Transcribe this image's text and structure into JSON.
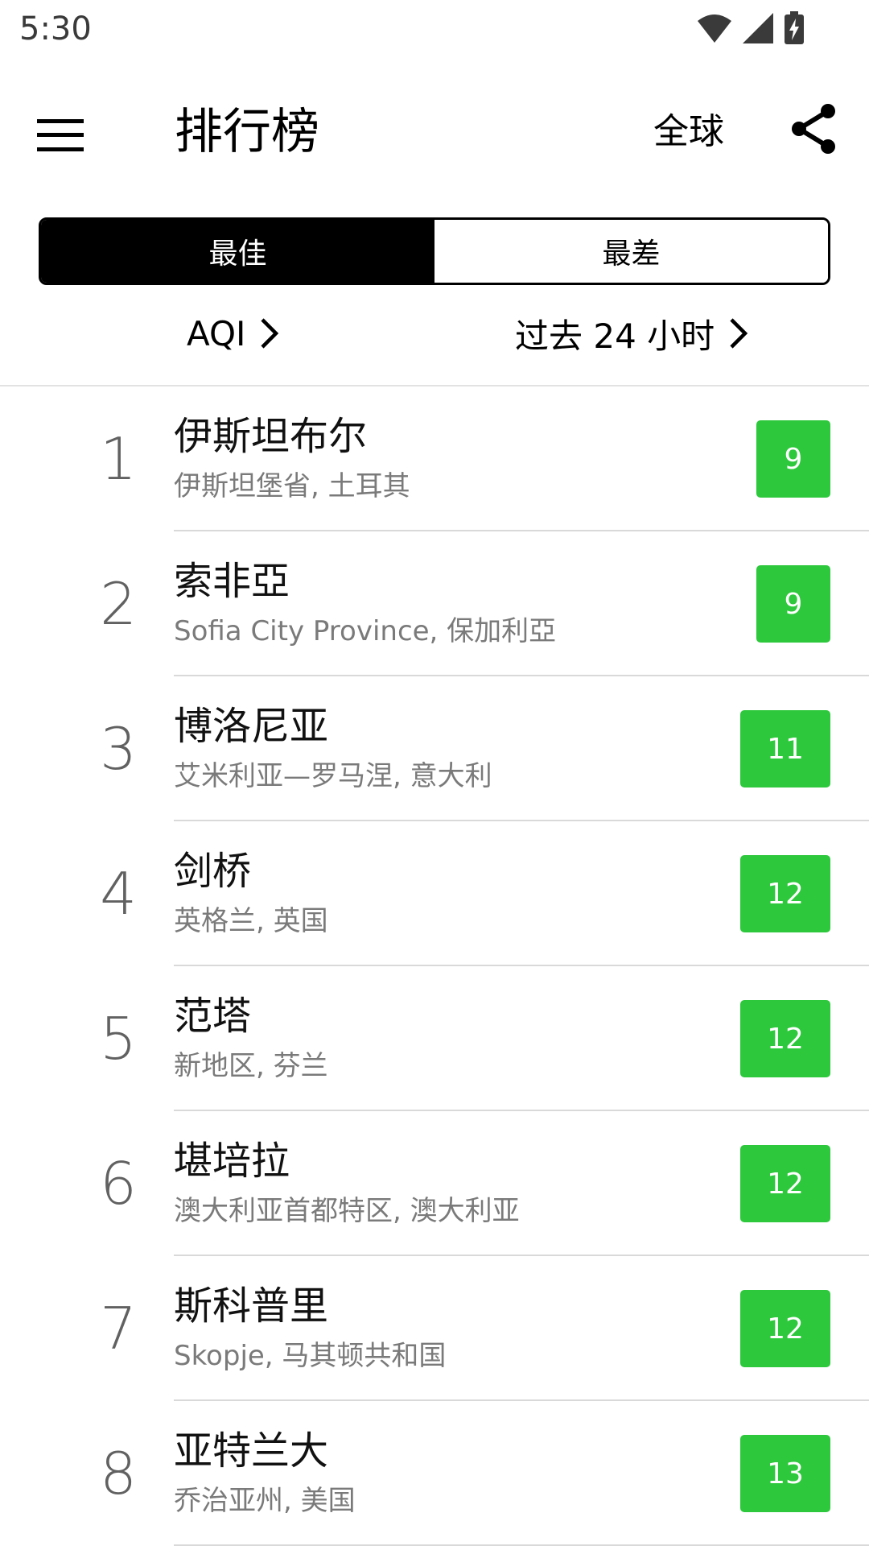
{
  "status_bar": {
    "time": "5:30",
    "icons": [
      "wifi-icon",
      "cellular-signal-icon",
      "battery-charging-icon"
    ]
  },
  "header": {
    "menu_icon": "hamburger-menu-icon",
    "title": "排行榜",
    "region": "全球",
    "share_icon": "share-icon"
  },
  "tabs": [
    {
      "label": "最佳",
      "selected": true
    },
    {
      "label": "最差",
      "selected": false
    }
  ],
  "filters": {
    "metric": "AQI",
    "period": "过去 24 小时"
  },
  "colors": {
    "good_badge": "#2dc83c",
    "active_tab_bg": "#000000"
  },
  "rankings": [
    {
      "rank": "1",
      "city": "伊斯坦布尔",
      "region": "伊斯坦堡省, 土耳其",
      "aqi": "9"
    },
    {
      "rank": "2",
      "city": "索非亞",
      "region": "Sofia City Province, 保加利亞",
      "aqi": "9"
    },
    {
      "rank": "3",
      "city": "博洛尼亚",
      "region": "艾米利亚—罗马涅, 意大利",
      "aqi": "11"
    },
    {
      "rank": "4",
      "city": "剑桥",
      "region": "英格兰, 英国",
      "aqi": "12"
    },
    {
      "rank": "5",
      "city": "范塔",
      "region": "新地区, 芬兰",
      "aqi": "12"
    },
    {
      "rank": "6",
      "city": "堪培拉",
      "region": "澳大利亚首都特区, 澳大利亚",
      "aqi": "12"
    },
    {
      "rank": "7",
      "city": "斯科普里",
      "region": "Skopje, 马其顿共和国",
      "aqi": "12"
    },
    {
      "rank": "8",
      "city": "亚特兰大",
      "region": "乔治亚州, 美国",
      "aqi": "13"
    }
  ]
}
